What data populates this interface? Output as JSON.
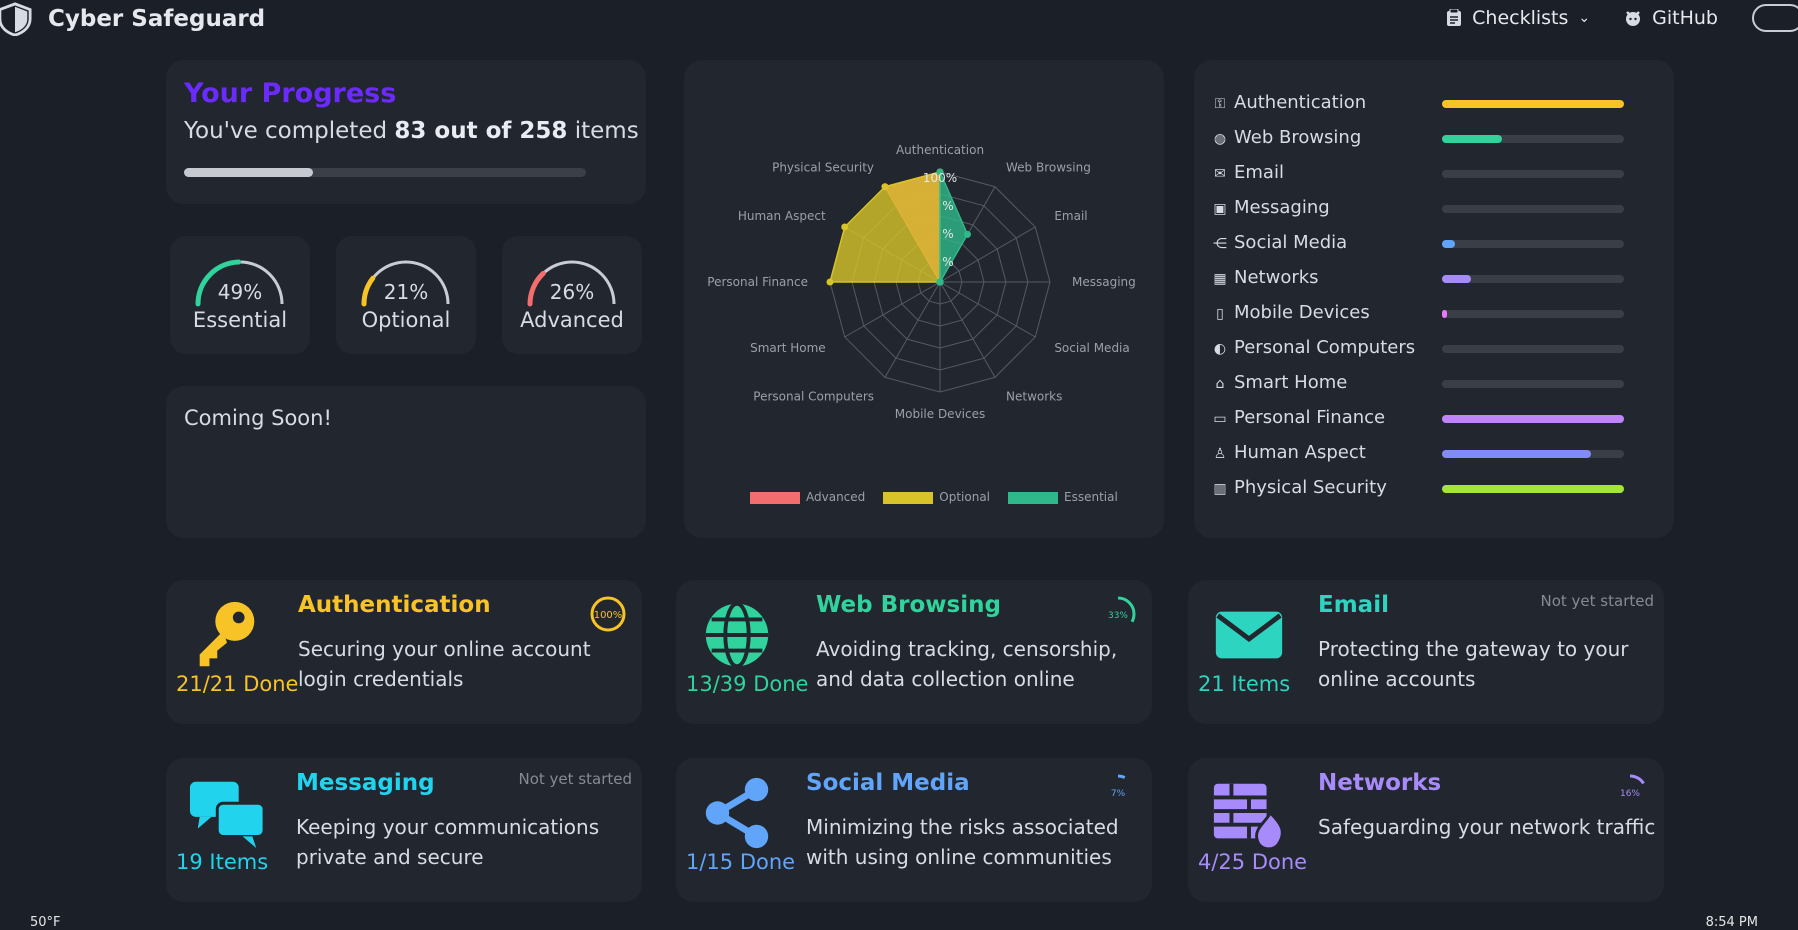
{
  "header": {
    "brand": "Cyber Safeguard",
    "nav_checklists": "Checklists",
    "nav_github": "GitHub"
  },
  "progress": {
    "title": "Your Progress",
    "text_prefix": "You've completed ",
    "text_bold": "83 out of 258",
    "text_suffix": " items",
    "fraction": 0.32
  },
  "gauges": [
    {
      "label": "Essential",
      "pct_text": "49%",
      "value": 49,
      "color": "#2fd39b"
    },
    {
      "label": "Optional",
      "pct_text": "21%",
      "value": 21,
      "color": "#f7c326"
    },
    {
      "label": "Advanced",
      "pct_text": "26%",
      "value": 26,
      "color": "#f26d6d"
    }
  ],
  "coming_soon": "Coming Soon!",
  "chart_data": {
    "type": "radar",
    "axes": [
      "Authentication",
      "Web Browsing",
      "Email",
      "Messaging",
      "Social Media",
      "Networks",
      "Mobile Devices",
      "Personal Computers",
      "Smart Home",
      "Personal Finance",
      "Human Aspect",
      "Physical Security"
    ],
    "series": [
      {
        "name": "Advanced",
        "color": "#f26d6d",
        "values": [
          100,
          0,
          0,
          0,
          0,
          0,
          0,
          0,
          0,
          0,
          0,
          100
        ]
      },
      {
        "name": "Optional",
        "color": "#d8c429",
        "values": [
          100,
          0,
          0,
          0,
          0,
          0,
          0,
          0,
          0,
          100,
          100,
          100
        ]
      },
      {
        "name": "Essential",
        "color": "#2fb98a",
        "values": [
          100,
          50,
          0,
          0,
          0,
          0,
          0,
          0,
          0,
          0,
          0,
          0
        ]
      }
    ],
    "visible_point_labels": [
      "100%",
      "%",
      "%",
      "%"
    ],
    "rlim": [
      0,
      100
    ],
    "legend_position": "bottom"
  },
  "categories": [
    {
      "name": "Authentication",
      "icon": "key-icon",
      "glyph": "⚿",
      "fraction": 1.0,
      "color": "#f7c326"
    },
    {
      "name": "Web Browsing",
      "icon": "globe-icon",
      "glyph": "◍",
      "fraction": 0.33,
      "color": "#2fd39b"
    },
    {
      "name": "Email",
      "icon": "envelope-icon",
      "glyph": "✉",
      "fraction": 0.0,
      "color": "#2dd4bf"
    },
    {
      "name": "Messaging",
      "icon": "chat-icon",
      "glyph": "▣",
      "fraction": 0.0,
      "color": "#22d3ee"
    },
    {
      "name": "Social Media",
      "icon": "share-icon",
      "glyph": "⋲",
      "fraction": 0.07,
      "color": "#60a5fa"
    },
    {
      "name": "Networks",
      "icon": "firewall-icon",
      "glyph": "▦",
      "fraction": 0.16,
      "color": "#a78bfa"
    },
    {
      "name": "Mobile Devices",
      "icon": "phone-icon",
      "glyph": "▯",
      "fraction": 0.03,
      "color": "#e879f9"
    },
    {
      "name": "Personal Computers",
      "icon": "mouse-icon",
      "glyph": "◐",
      "fraction": 0.0,
      "color": "#f472b6"
    },
    {
      "name": "Smart Home",
      "icon": "smart-home-icon",
      "glyph": "⌂",
      "fraction": 0.0,
      "color": "#fb7185"
    },
    {
      "name": "Personal Finance",
      "icon": "card-icon",
      "glyph": "▭",
      "fraction": 1.0,
      "color": "#c084fc"
    },
    {
      "name": "Human Aspect",
      "icon": "person-icon",
      "glyph": "♙",
      "fraction": 0.82,
      "color": "#818cf8"
    },
    {
      "name": "Physical Security",
      "icon": "building-icon",
      "glyph": "▥",
      "fraction": 1.0,
      "color": "#a3e635"
    }
  ],
  "tiles": [
    {
      "title": "Authentication",
      "desc": "Securing your online account login credentials",
      "count": "21/21 Done",
      "color": "#f7c326",
      "status": "",
      "ring": "100%"
    },
    {
      "title": "Web Browsing",
      "desc": "Avoiding tracking, censorship, and data collection online",
      "count": "13/39 Done",
      "color": "#2fd39b",
      "status": "",
      "ring": "33%"
    },
    {
      "title": "Email",
      "desc": "Protecting the gateway to your online accounts",
      "count": "21 Items",
      "color": "#2dd4bf",
      "status": "Not yet started",
      "ring": ""
    },
    {
      "title": "Messaging",
      "desc": "Keeping your communications private and secure",
      "count": "19 Items",
      "color": "#22d3ee",
      "status": "Not yet started",
      "ring": ""
    },
    {
      "title": "Social Media",
      "desc": "Minimizing the risks associated with using online communities",
      "count": "1/15 Done",
      "color": "#60a5fa",
      "status": "",
      "ring": "7%"
    },
    {
      "title": "Networks",
      "desc": "Safeguarding your network traffic",
      "count": "4/25 Done",
      "color": "#a78bfa",
      "status": "",
      "ring": "16%"
    }
  ],
  "taskbar": {
    "weather": "50°F",
    "time": "8:54 PM"
  }
}
